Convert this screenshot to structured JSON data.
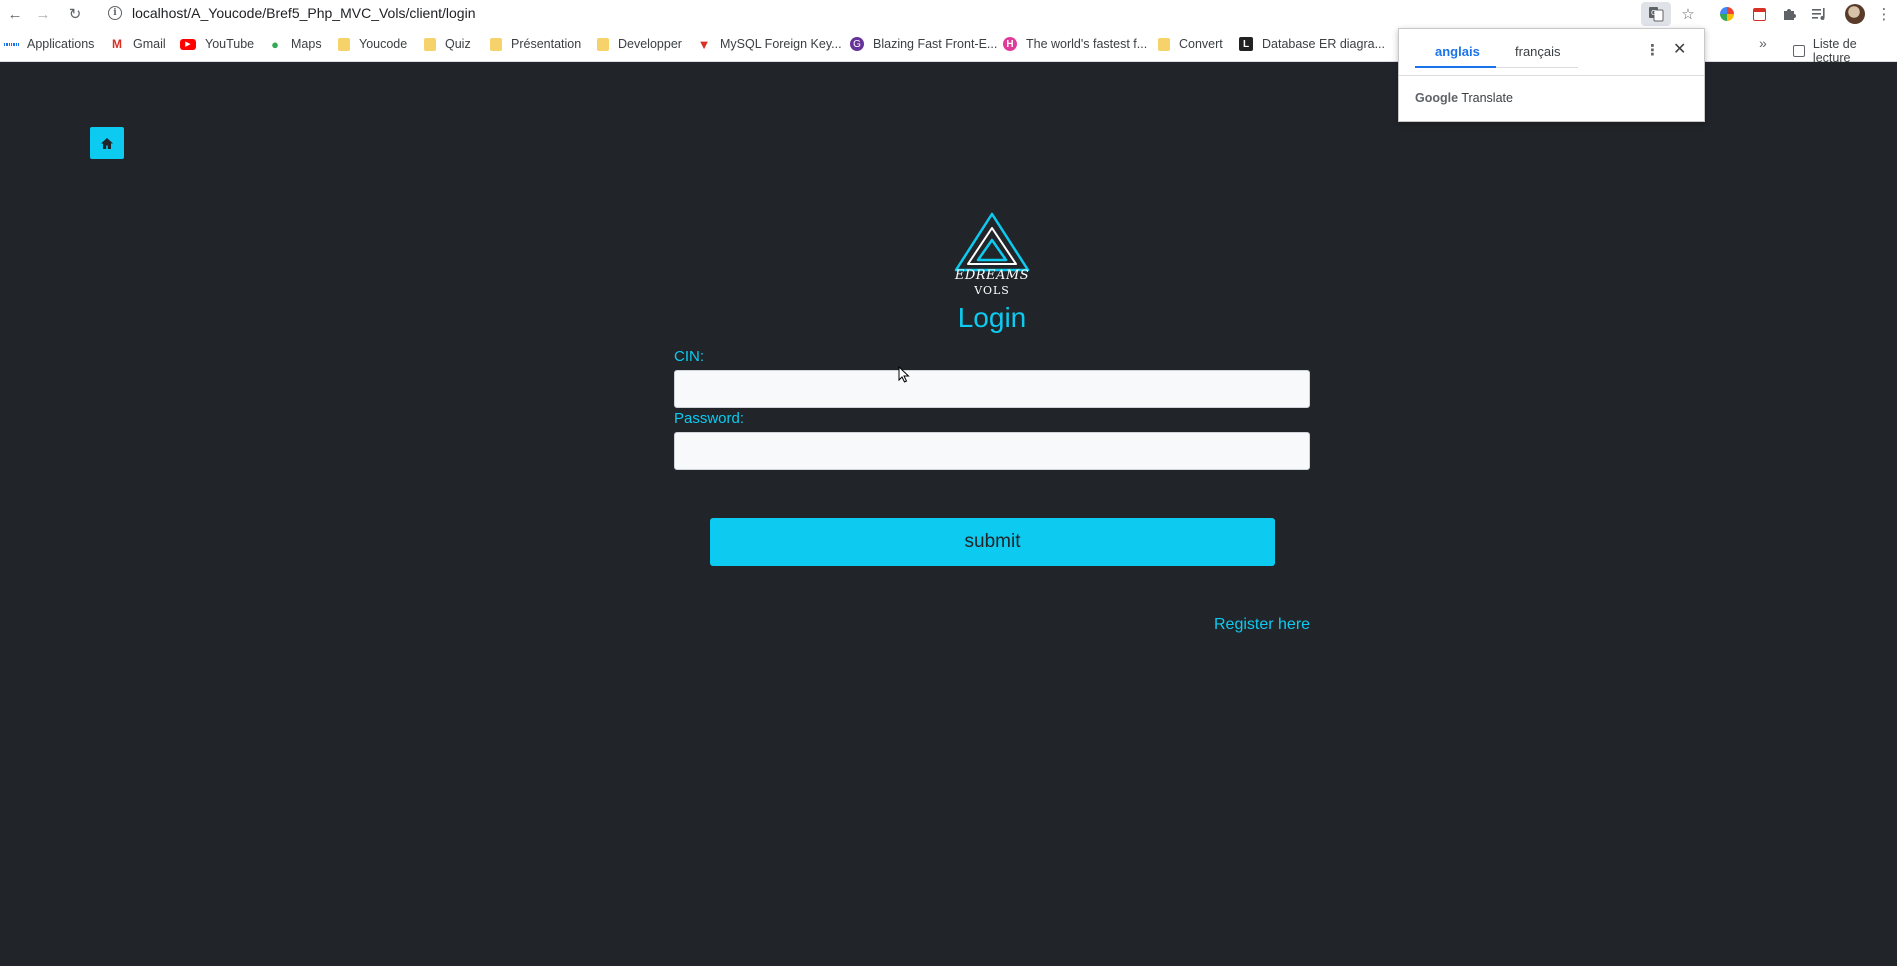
{
  "browser": {
    "url": "localhost/A_Youcode/Bref5_Php_MVC_Vols/client/login",
    "bookmarks": [
      {
        "label": "Applications",
        "icon": "apps-grid-icon"
      },
      {
        "label": "Gmail",
        "icon": "gmail-icon"
      },
      {
        "label": "YouTube",
        "icon": "youtube-icon"
      },
      {
        "label": "Maps",
        "icon": "maps-pin-icon"
      },
      {
        "label": "Youcode",
        "icon": "folder-icon"
      },
      {
        "label": "Quiz",
        "icon": "folder-icon"
      },
      {
        "label": "Présentation",
        "icon": "folder-icon"
      },
      {
        "label": "Developper",
        "icon": "folder-icon"
      },
      {
        "label": "MySQL Foreign Key...",
        "icon": "mysql-icon"
      },
      {
        "label": "Blazing Fast Front-E...",
        "icon": "gatsby-icon"
      },
      {
        "label": "The world's fastest f...",
        "icon": "h-icon"
      },
      {
        "label": "Convert",
        "icon": "folder-icon"
      },
      {
        "label": "Database ER diagra...",
        "icon": "dbdiagram-icon"
      }
    ],
    "more_bookmarks": "»",
    "reading_list": "Liste de lecture"
  },
  "translate_popup": {
    "tab_source": "anglais",
    "tab_target": "français",
    "brand_google": "Google",
    "brand_translate": "Translate"
  },
  "page": {
    "logo_name": "EDREAMS",
    "logo_sub": "VOLS",
    "title": "Login",
    "cin_label": "CIN:",
    "cin_value": "",
    "password_label": "Password:",
    "password_value": "",
    "submit_label": "submit",
    "register_link": "Register here"
  },
  "colors": {
    "accent": "#0dcaf0",
    "background": "#212529",
    "input_bg": "#f8f9fa"
  }
}
